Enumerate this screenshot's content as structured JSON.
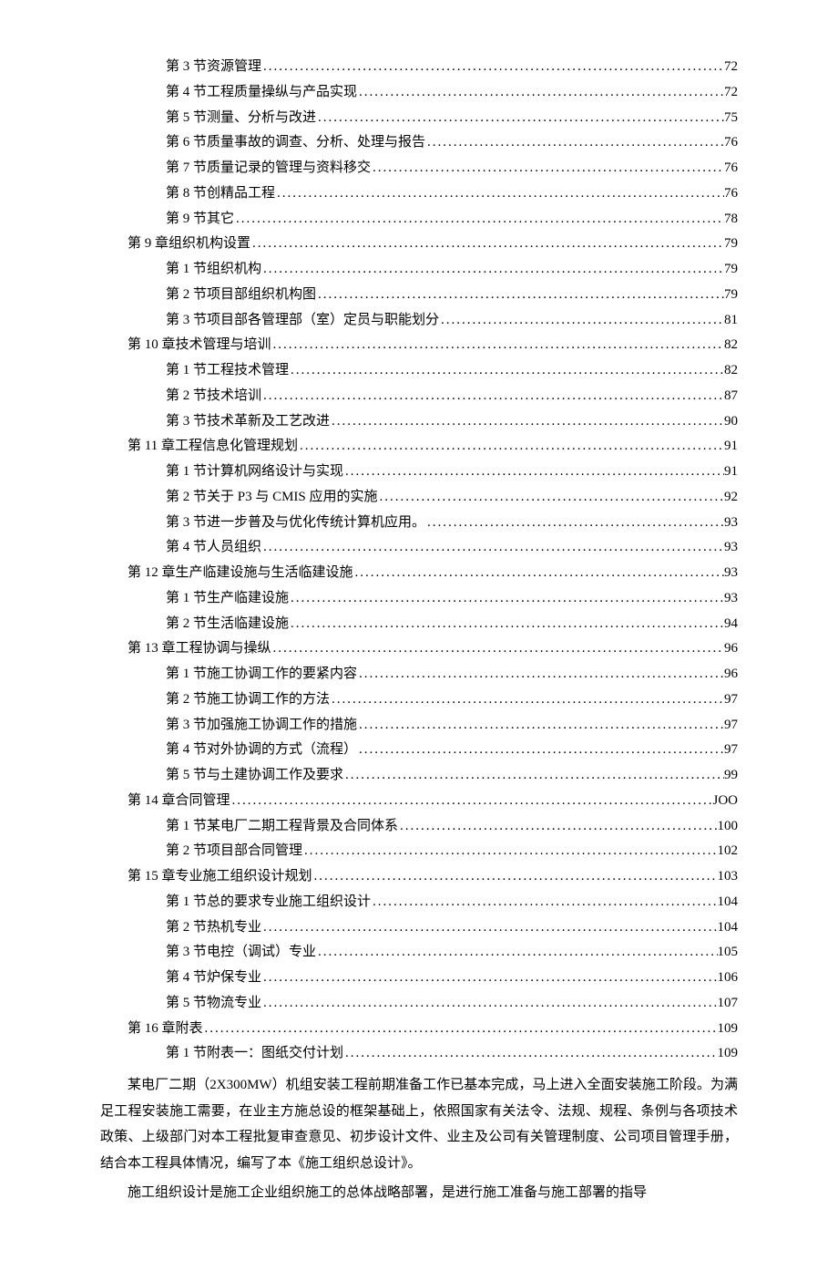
{
  "toc": [
    {
      "level": 1,
      "title": "第 3 节资源管理",
      "page": "72"
    },
    {
      "level": 1,
      "title": "第 4 节工程质量操纵与产品实现",
      "page": "72"
    },
    {
      "level": 1,
      "title": "第 5 节测量、分析与改进",
      "page": "75"
    },
    {
      "level": 1,
      "title": "第 6 节质量事故的调查、分析、处理与报告",
      "page": "76"
    },
    {
      "level": 1,
      "title": "第 7 节质量记录的管理与资料移交",
      "page": "76"
    },
    {
      "level": 1,
      "title": "第 8 节创精品工程",
      "page": "76"
    },
    {
      "level": 1,
      "title": "第 9 节其它",
      "page": "78"
    },
    {
      "level": 0,
      "title": "第 9 章组织机构设置",
      "page": "79"
    },
    {
      "level": 1,
      "title": "第 1 节组织机构",
      "page": "79"
    },
    {
      "level": 1,
      "title": "第 2 节项目部组织机构图",
      "page": "79"
    },
    {
      "level": 1,
      "title": "第 3 节项目部各管理部（室）定员与职能划分",
      "page": "81"
    },
    {
      "level": 0,
      "title": "第 10 章技术管理与培训",
      "page": "82"
    },
    {
      "level": 1,
      "title": "第 1 节工程技术管理",
      "page": "82"
    },
    {
      "level": 1,
      "title": "第 2 节技术培训",
      "page": "87"
    },
    {
      "level": 1,
      "title": "第 3 节技术革新及工艺改进",
      "page": "90"
    },
    {
      "level": 0,
      "title": "第 11 章工程信息化管理规划",
      "page": "91"
    },
    {
      "level": 1,
      "title": "第 1 节计算机网络设计与实现",
      "page": "91"
    },
    {
      "level": 1,
      "title": "第 2 节关于 P3 与 CMIS 应用的实施",
      "page": "92"
    },
    {
      "level": 1,
      "title": "第 3 节进一步普及与优化传统计算机应用。",
      "page": "93"
    },
    {
      "level": 1,
      "title": "第 4 节人员组织",
      "page": "93"
    },
    {
      "level": 0,
      "title": "第 12 章生产临建设施与生活临建设施",
      "page": "93"
    },
    {
      "level": 1,
      "title": "第 1 节生产临建设施",
      "page": "93"
    },
    {
      "level": 1,
      "title": "第 2 节生活临建设施",
      "page": "94"
    },
    {
      "level": 0,
      "title": "第 13 章工程协调与操纵",
      "page": "96"
    },
    {
      "level": 1,
      "title": "第 1 节施工协调工作的要紧内容",
      "page": "96"
    },
    {
      "level": 1,
      "title": "第 2 节施工协调工作的方法",
      "page": "97"
    },
    {
      "level": 1,
      "title": "第 3 节加强施工协调工作的措施",
      "page": "97"
    },
    {
      "level": 1,
      "title": "第 4 节对外协调的方式（流程）",
      "page": "97"
    },
    {
      "level": 1,
      "title": "第 5 节与土建协调工作及要求",
      "page": "99"
    },
    {
      "level": 0,
      "title": "第 14 章合同管理",
      "page": "JOO"
    },
    {
      "level": 1,
      "title": "第 1 节某电厂二期工程背景及合同体系",
      "page": "100"
    },
    {
      "level": 1,
      "title": "第 2 节项目部合同管理",
      "page": "102"
    },
    {
      "level": 0,
      "title": "第 15 章专业施工组织设计规划",
      "page": "103"
    },
    {
      "level": 1,
      "title": "第 1 节总的要求专业施工组织设计",
      "page": "104"
    },
    {
      "level": 1,
      "title": "第 2 节热机专业",
      "page": "104"
    },
    {
      "level": 1,
      "title": "第 3 节电控（调试）专业",
      "page": "105"
    },
    {
      "level": 1,
      "title": "第 4 节炉保专业",
      "page": "106"
    },
    {
      "level": 1,
      "title": "第 5 节物流专业",
      "page": "107"
    },
    {
      "level": 0,
      "title": "第 16 章附表",
      "page": "109"
    },
    {
      "level": 1,
      "title": "第 1 节附表一：图纸交付计划",
      "page": "109"
    }
  ],
  "paragraphs": [
    "某电厂二期（2X300MW）机组安装工程前期准备工作已基本完成，马上进入全面安装施工阶段。为满足工程安装施工需要，在业主方施总设的框架基础上，依照国家有关法令、法规、规程、条例与各项技术政策、上级部门对本工程批复审查意见、初步设计文件、业主及公司有关管理制度、公司项目管理手册，结合本工程具体情况，编写了本《施工组织总设计》。",
    "施工组织设计是施工企业组织施工的总体战略部署，是进行施工准备与施工部署的指导"
  ]
}
